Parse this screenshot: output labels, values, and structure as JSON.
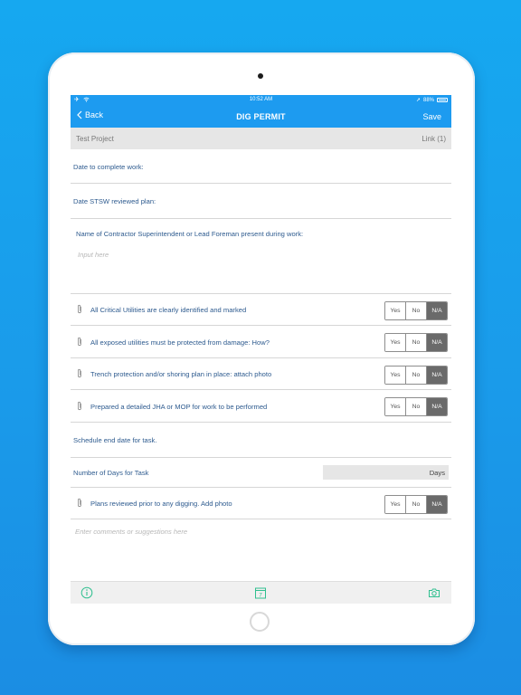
{
  "status_bar": {
    "time": "10:52 AM",
    "battery": "88%"
  },
  "nav": {
    "back_label": "Back",
    "title": "DIG PERMIT",
    "save_label": "Save"
  },
  "subheader": {
    "project": "Test Project",
    "link": "Link (1)"
  },
  "form": {
    "date_complete_label": "Date to complete work:",
    "date_reviewed_label": "Date STSW reviewed plan:",
    "contractor_label": "Name of Contractor Superintendent or Lead Foreman present during work:",
    "contractor_placeholder": "Input here",
    "checks": [
      {
        "label": "All Critical Utilities are clearly identified and marked",
        "options": [
          "Yes",
          "No",
          "N/A"
        ],
        "selected": "N/A"
      },
      {
        "label": "All exposed utilities must be protected from damage:  How?",
        "options": [
          "Yes",
          "No",
          "N/A"
        ],
        "selected": "N/A"
      },
      {
        "label": "Trench protection and/or shoring plan in place:  attach photo",
        "options": [
          "Yes",
          "No",
          "N/A"
        ],
        "selected": "N/A"
      },
      {
        "label": "Prepared a detailed JHA or MOP for work to be performed",
        "options": [
          "Yes",
          "No",
          "N/A"
        ],
        "selected": "N/A"
      }
    ],
    "schedule_label": "Schedule end date for task.",
    "days_label": "Number of Days for Task",
    "days_unit": "Days",
    "plans_check": {
      "label": "Plans reviewed prior to any digging.  Add photo",
      "options": [
        "Yes",
        "No",
        "N/A"
      ],
      "selected": "N/A"
    },
    "comments_placeholder": "Enter comments or suggestions here"
  },
  "toolbar": {
    "calendar_day": "7"
  },
  "icons": {
    "back": "chevron-left-icon",
    "airplane": "airplane-icon",
    "wifi": "wifi-icon",
    "location": "location-arrow-icon",
    "battery": "battery-icon",
    "attachment": "paperclip-icon",
    "info": "info-icon",
    "calendar": "calendar-icon",
    "camera": "camera-icon"
  },
  "colors": {
    "accent": "#1d9bf0",
    "label": "#2e5b8f",
    "toolbar_icon": "#2fbf8f",
    "selected_segment": "#6a6a6a"
  }
}
